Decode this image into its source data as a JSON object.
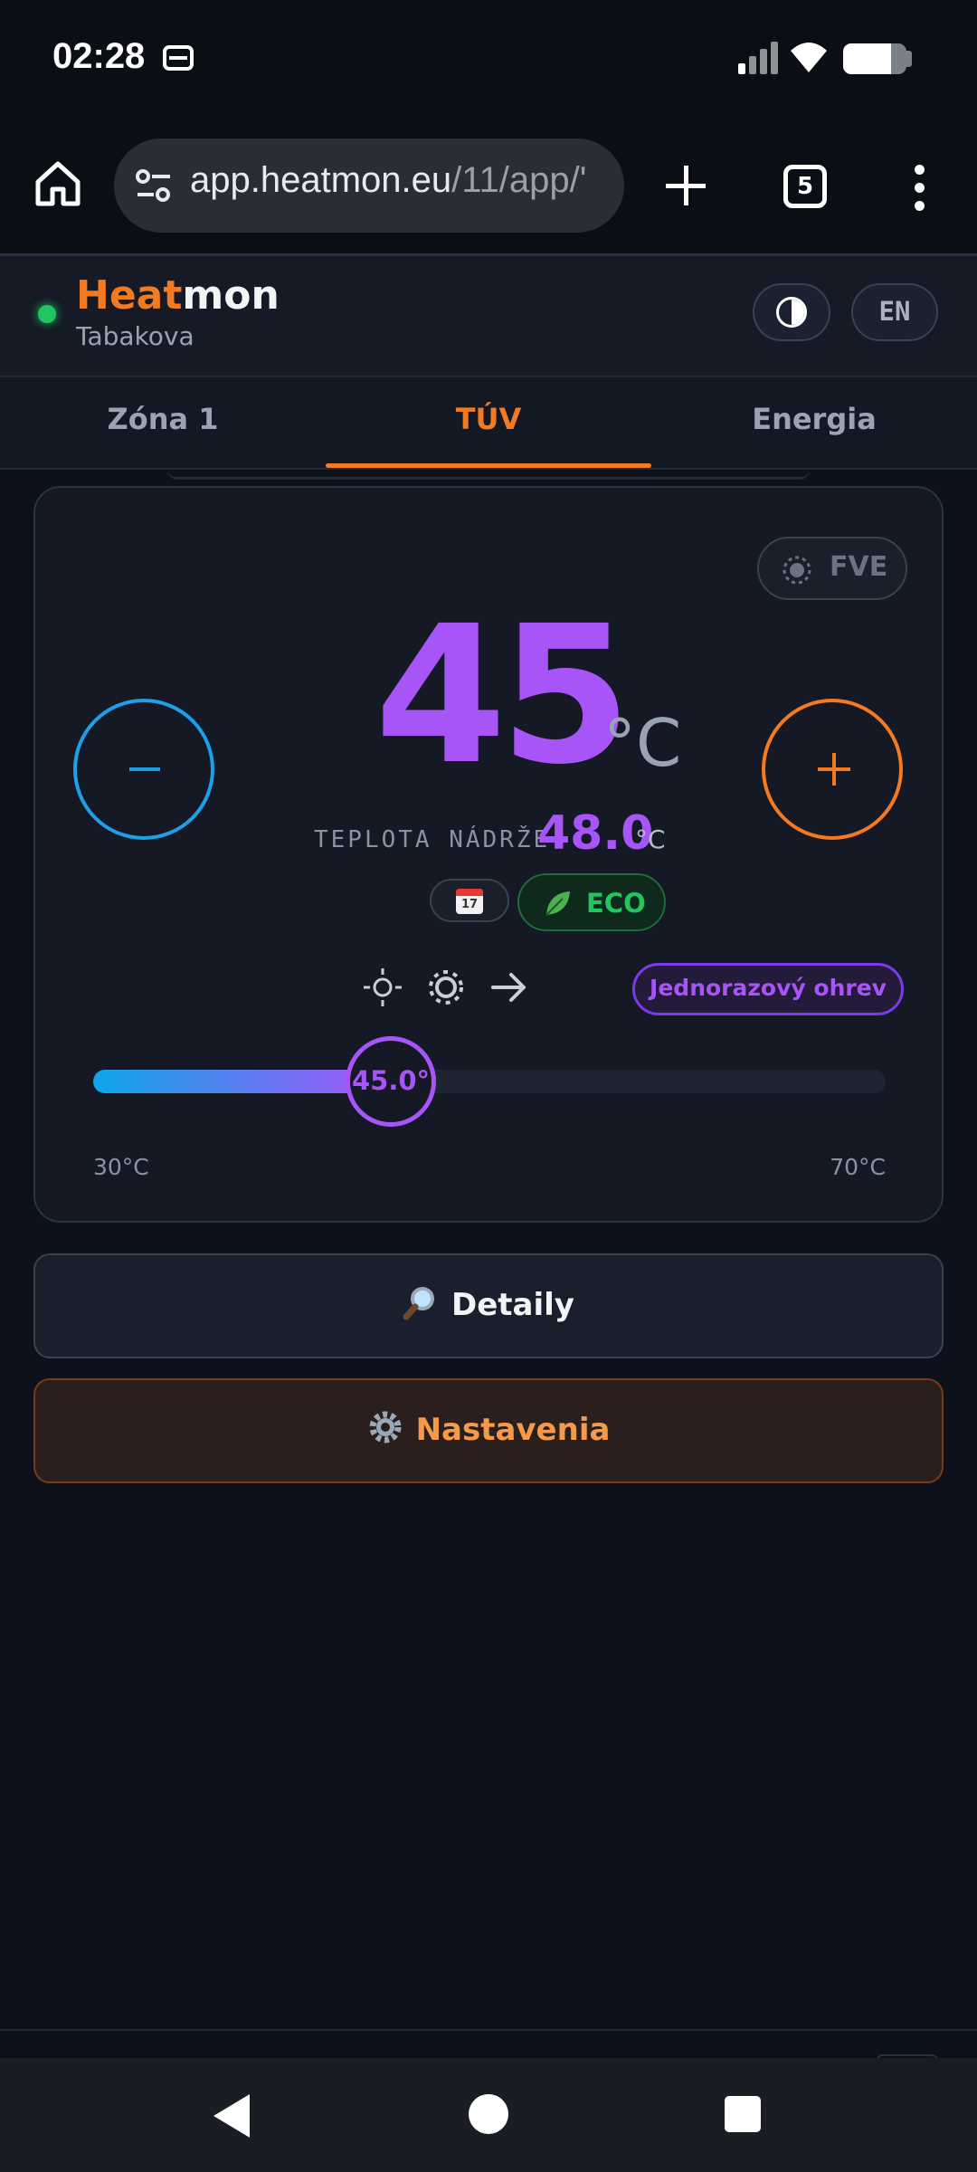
{
  "status_bar": {
    "time": "02:28",
    "icons": [
      "message-icon",
      "signal-icon",
      "wifi-icon",
      "battery-icon"
    ],
    "battery_level": 0.75
  },
  "browser": {
    "url_host": "app.heatmon.eu",
    "url_path": "/11/app/'",
    "tab_count": "5",
    "icons": [
      "home-icon",
      "site-settings-icon",
      "new-tab-icon",
      "tab-switcher-icon",
      "more-menu-icon"
    ]
  },
  "app": {
    "brand_part1": "Heat",
    "brand_part2": "mon",
    "site_name": "Tabakova",
    "status": "online",
    "language": "EN",
    "colors": {
      "accent": "#f47a22",
      "primary": "#a855f7",
      "cool": "#1ea0e8",
      "eco": "#22c55e"
    }
  },
  "tabs": [
    {
      "label": "Zóna 1",
      "active": false
    },
    {
      "label": "TÚV",
      "active": true
    },
    {
      "label": "Energia",
      "active": false
    }
  ],
  "dhw": {
    "fve_label": "FVE",
    "setpoint": "45",
    "unit": "°C",
    "tank_label": "TEPLOTA NÁDRŽE",
    "tank_value": "48.0",
    "tank_unit": "°C",
    "schedule_icon_text": "17",
    "eco_label": "ECO",
    "mode_icons": [
      "sun-outline-icon",
      "sun-gear-icon",
      "arrow-right-icon"
    ],
    "boost_label": "Jednorazový ohrev",
    "slider": {
      "value_label": "45.0°",
      "value": 45.0,
      "min": 30,
      "max": 70,
      "min_label": "30°C",
      "max_label": "70°C"
    }
  },
  "actions": {
    "details_label": "Detaily",
    "settings_label": "Nastavenia"
  }
}
